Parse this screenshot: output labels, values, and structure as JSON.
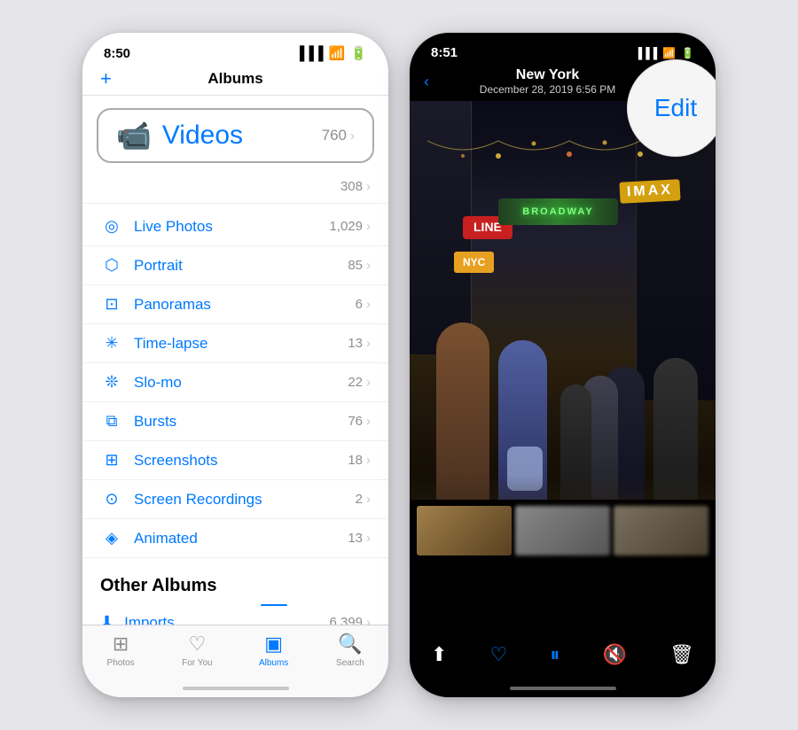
{
  "left_phone": {
    "status_bar": {
      "time": "8:50",
      "signal_icon": "signal-bars-icon",
      "wifi_icon": "wifi-icon",
      "battery_icon": "battery-icon"
    },
    "header": {
      "plus_label": "+",
      "title": "Albums"
    },
    "videos_row": {
      "icon": "video-camera-icon",
      "label": "Videos",
      "count": "760",
      "chevron": "›"
    },
    "blank_row": {
      "count": "308",
      "chevron": "›"
    },
    "album_items": [
      {
        "icon": "live-photos-icon",
        "name": "Live Photos",
        "count": "1,029",
        "chevron": "›"
      },
      {
        "icon": "portrait-icon",
        "name": "Portrait",
        "count": "85",
        "chevron": "›"
      },
      {
        "icon": "panoramas-icon",
        "name": "Panoramas",
        "count": "6",
        "chevron": "›"
      },
      {
        "icon": "timelapse-icon",
        "name": "Time-lapse",
        "count": "13",
        "chevron": "›"
      },
      {
        "icon": "slomo-icon",
        "name": "Slo-mo",
        "count": "22",
        "chevron": "›"
      },
      {
        "icon": "bursts-icon",
        "name": "Bursts",
        "count": "76",
        "chevron": "›"
      },
      {
        "icon": "screenshots-icon",
        "name": "Screenshots",
        "count": "18",
        "chevron": "›"
      },
      {
        "icon": "screen-rec-icon",
        "name": "Screen Recordings",
        "count": "2",
        "chevron": "›"
      },
      {
        "icon": "animated-icon",
        "name": "Animated",
        "count": "13",
        "chevron": "›"
      }
    ],
    "other_albums_header": "Other Albums",
    "imports_row": {
      "icon": "imports-icon",
      "name": "Imports",
      "count": "6,399",
      "chevron": "›"
    },
    "tab_bar": {
      "tabs": [
        {
          "icon": "photos-tab-icon",
          "label": "Photos",
          "active": false
        },
        {
          "icon": "for-you-tab-icon",
          "label": "For You",
          "active": false
        },
        {
          "icon": "albums-tab-icon",
          "label": "Albums",
          "active": true
        },
        {
          "icon": "search-tab-icon",
          "label": "Search",
          "active": false
        }
      ]
    }
  },
  "right_phone": {
    "status_bar": {
      "time": "8:51",
      "signal_icon": "signal-bars-icon",
      "wifi_icon": "wifi-icon",
      "battery_icon": "battery-icon"
    },
    "header": {
      "back_label": "‹",
      "photo_title": "New York",
      "photo_date": "December 28, 2019  6:56 PM",
      "edit_label": "Edit"
    },
    "toolbar": {
      "share_icon": "share-icon",
      "heart_icon": "heart-icon",
      "pause_icon": "pause-icon",
      "mute_icon": "mute-icon",
      "trash_icon": "trash-icon"
    }
  }
}
